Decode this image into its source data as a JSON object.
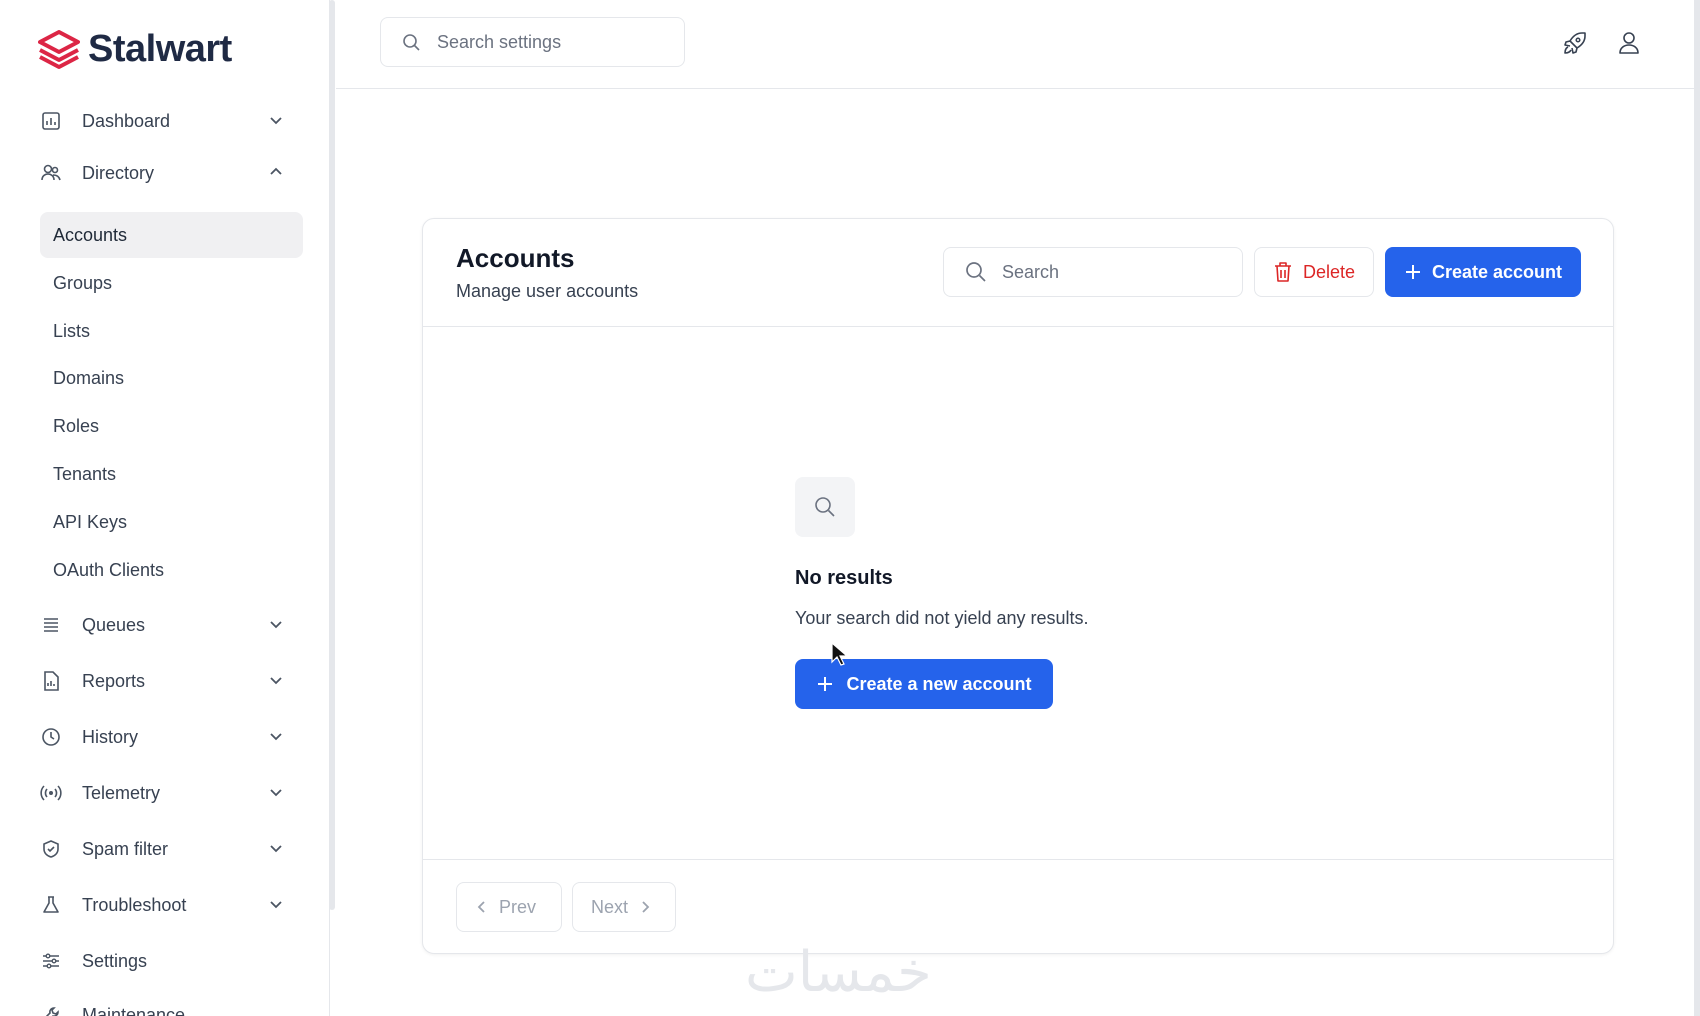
{
  "brand": {
    "name": "Stalwart",
    "logo_color": "#dc2645"
  },
  "sidebar": {
    "items": [
      {
        "label": "Dashboard",
        "icon": "chart-icon",
        "state": "collapsed"
      },
      {
        "label": "Directory",
        "icon": "users-icon",
        "state": "expanded"
      },
      {
        "label": "Queues",
        "icon": "queue-icon",
        "state": "collapsed"
      },
      {
        "label": "Reports",
        "icon": "report-icon",
        "state": "collapsed"
      },
      {
        "label": "History",
        "icon": "clock-icon",
        "state": "collapsed"
      },
      {
        "label": "Telemetry",
        "icon": "broadcast-icon",
        "state": "collapsed"
      },
      {
        "label": "Spam filter",
        "icon": "shield-icon",
        "state": "collapsed"
      },
      {
        "label": "Troubleshoot",
        "icon": "flask-icon",
        "state": "collapsed"
      },
      {
        "label": "Settings",
        "icon": "sliders-icon",
        "state": "none"
      },
      {
        "label": "Maintenance",
        "icon": "wrench-icon",
        "state": "none"
      }
    ],
    "directory_sub": [
      "Accounts",
      "Groups",
      "Lists",
      "Domains",
      "Roles",
      "Tenants",
      "API Keys",
      "OAuth Clients"
    ],
    "active_sub": "Accounts"
  },
  "topbar": {
    "search_placeholder": "Search settings",
    "icons": [
      "rocket-icon",
      "user-icon"
    ]
  },
  "page": {
    "title": "Accounts",
    "subtitle": "Manage user accounts",
    "search_placeholder": "Search",
    "delete_label": "Delete",
    "create_label": "Create account"
  },
  "empty_state": {
    "title": "No results",
    "text": "Your search did not yield any results.",
    "button_label": "Create a new account"
  },
  "pagination": {
    "prev_label": "Prev",
    "next_label": "Next"
  },
  "colors": {
    "accent": "#2563eb",
    "danger": "#dc2626",
    "active_bg": "#f0f0f2"
  },
  "watermark": "خمسات"
}
